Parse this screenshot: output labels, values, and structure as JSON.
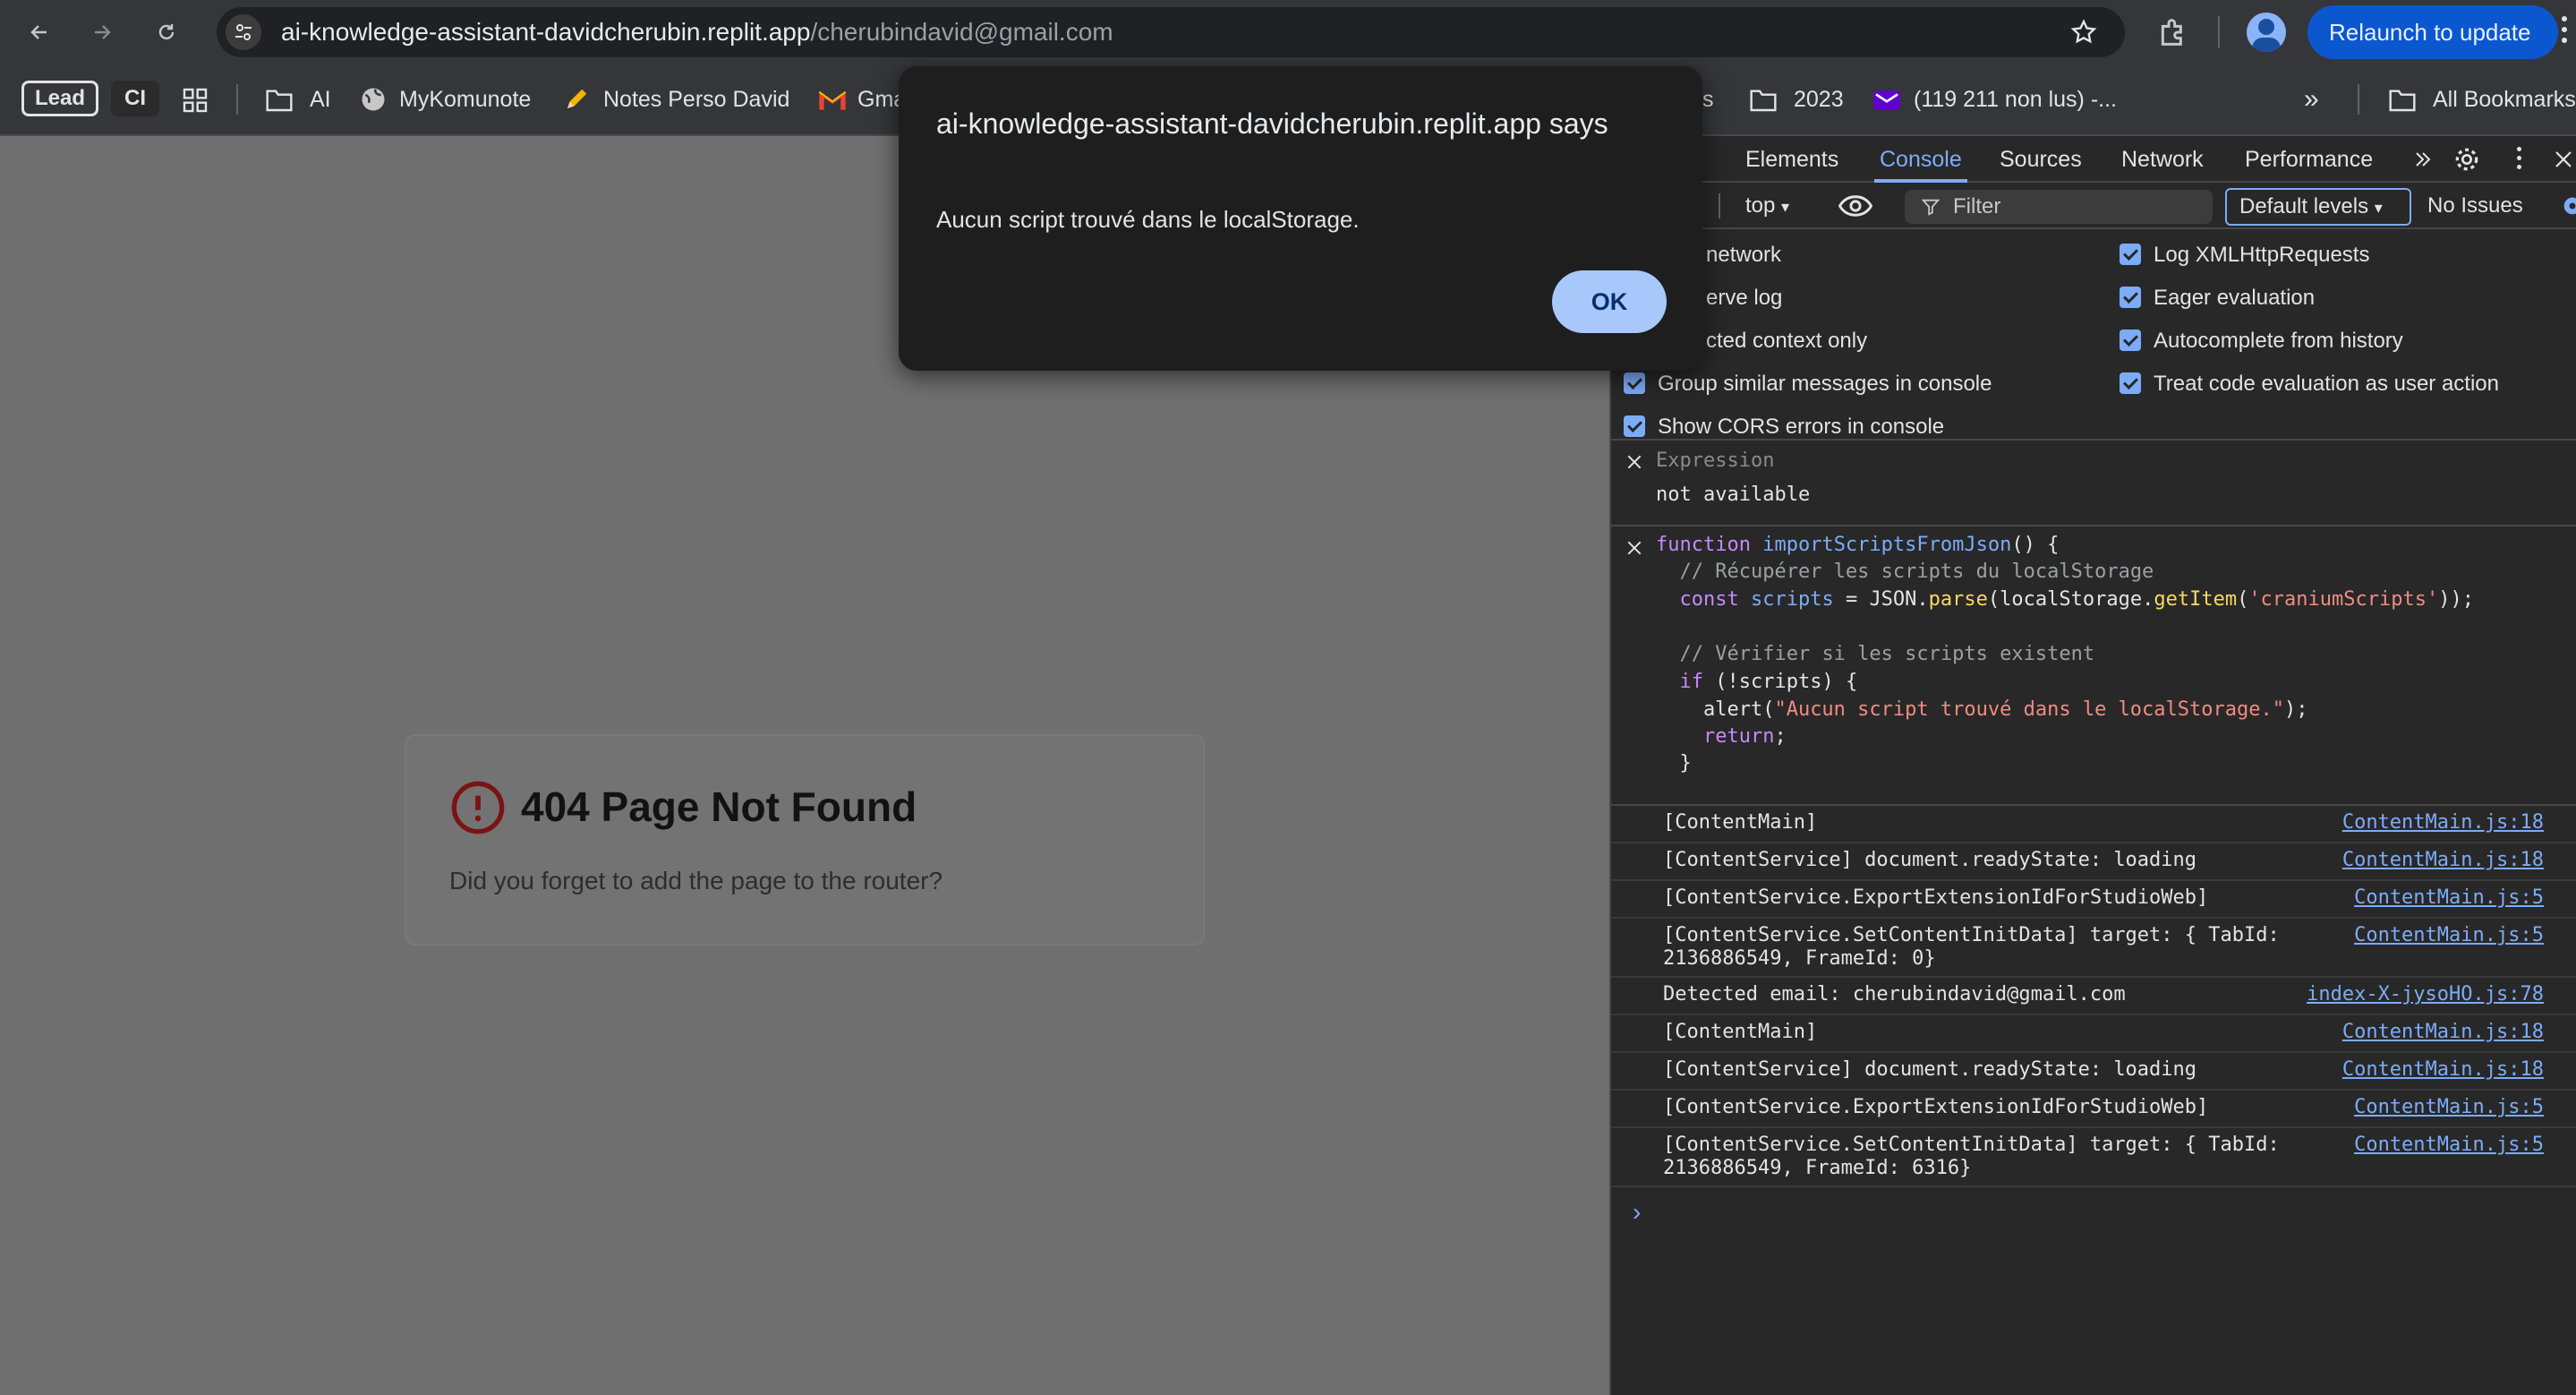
{
  "toolbar": {
    "url_host": "ai-knowledge-assistant-davidcherubin.replit.app",
    "url_path": "/cherubindavid@gmail.com",
    "relaunch_label": "Relaunch to update"
  },
  "bookmarks": {
    "lead": "Lead",
    "ci": "CI",
    "ai": "AI",
    "mykomunote": "MyKomunote",
    "notes_perso": "Notes Perso David",
    "gmail": "Gma",
    "s_partial": "s",
    "y2023": "2023",
    "yahoo": "(119 211 non lus) -...",
    "overflow": "»",
    "all_bookmarks": "All Bookmarks"
  },
  "page": {
    "error_title": "404 Page Not Found",
    "error_message": "Did you forget to add the page to the router?"
  },
  "dialog": {
    "title": "ai-knowledge-assistant-davidcherubin.replit.app says",
    "message": "Aucun script trouvé dans le localStorage.",
    "ok_label": "OK"
  },
  "devtools": {
    "tabs": [
      "Elements",
      "Console",
      "Sources",
      "Network",
      "Performance"
    ],
    "active_tab": "Console",
    "context": "top",
    "filter_placeholder": "Filter",
    "levels": "Default levels",
    "issues": "No Issues",
    "settings_left": [
      "network",
      "erve log",
      "cted context only",
      "Group similar messages in console",
      "Show CORS errors in console"
    ],
    "settings_right": [
      "Log XMLHttpRequests",
      "Eager evaluation",
      "Autocomplete from history",
      "Treat code evaluation as user action"
    ],
    "expression_label": "Expression",
    "expression_value": "not available",
    "code": [
      "function importScriptsFromJson() {",
      "  // Récupérer les scripts du localStorage",
      "  const scripts = JSON.parse(localStorage.getItem('craniumScripts'));",
      "",
      "  // Vérifier si les scripts existent",
      "  if (!scripts) {",
      "    alert(\"Aucun script trouvé dans le localStorage.\");",
      "    return;",
      "  }"
    ],
    "logs": [
      {
        "msg": "[ContentMain]",
        "src": "ContentMain.js:18"
      },
      {
        "msg": "[ContentService] document.readyState: loading",
        "src": "ContentMain.js:18"
      },
      {
        "msg": "[ContentService.ExportExtensionIdForStudioWeb]",
        "src": "ContentMain.js:5"
      },
      {
        "msg": "[ContentService.SetContentInitData] target: { TabId:\n2136886549, FrameId: 0}",
        "src": "ContentMain.js:5"
      },
      {
        "msg": "Detected email: cherubindavid@gmail.com",
        "src": "index-X-jysoHO.js:78"
      },
      {
        "msg": "[ContentMain]",
        "src": "ContentMain.js:18"
      },
      {
        "msg": "[ContentService] document.readyState: loading",
        "src": "ContentMain.js:18"
      },
      {
        "msg": "[ContentService.ExportExtensionIdForStudioWeb]",
        "src": "ContentMain.js:5"
      },
      {
        "msg": "[ContentService.SetContentInitData] target: { TabId:\n2136886549, FrameId: 6316}",
        "src": "ContentMain.js:5"
      }
    ],
    "prompt": "›"
  }
}
